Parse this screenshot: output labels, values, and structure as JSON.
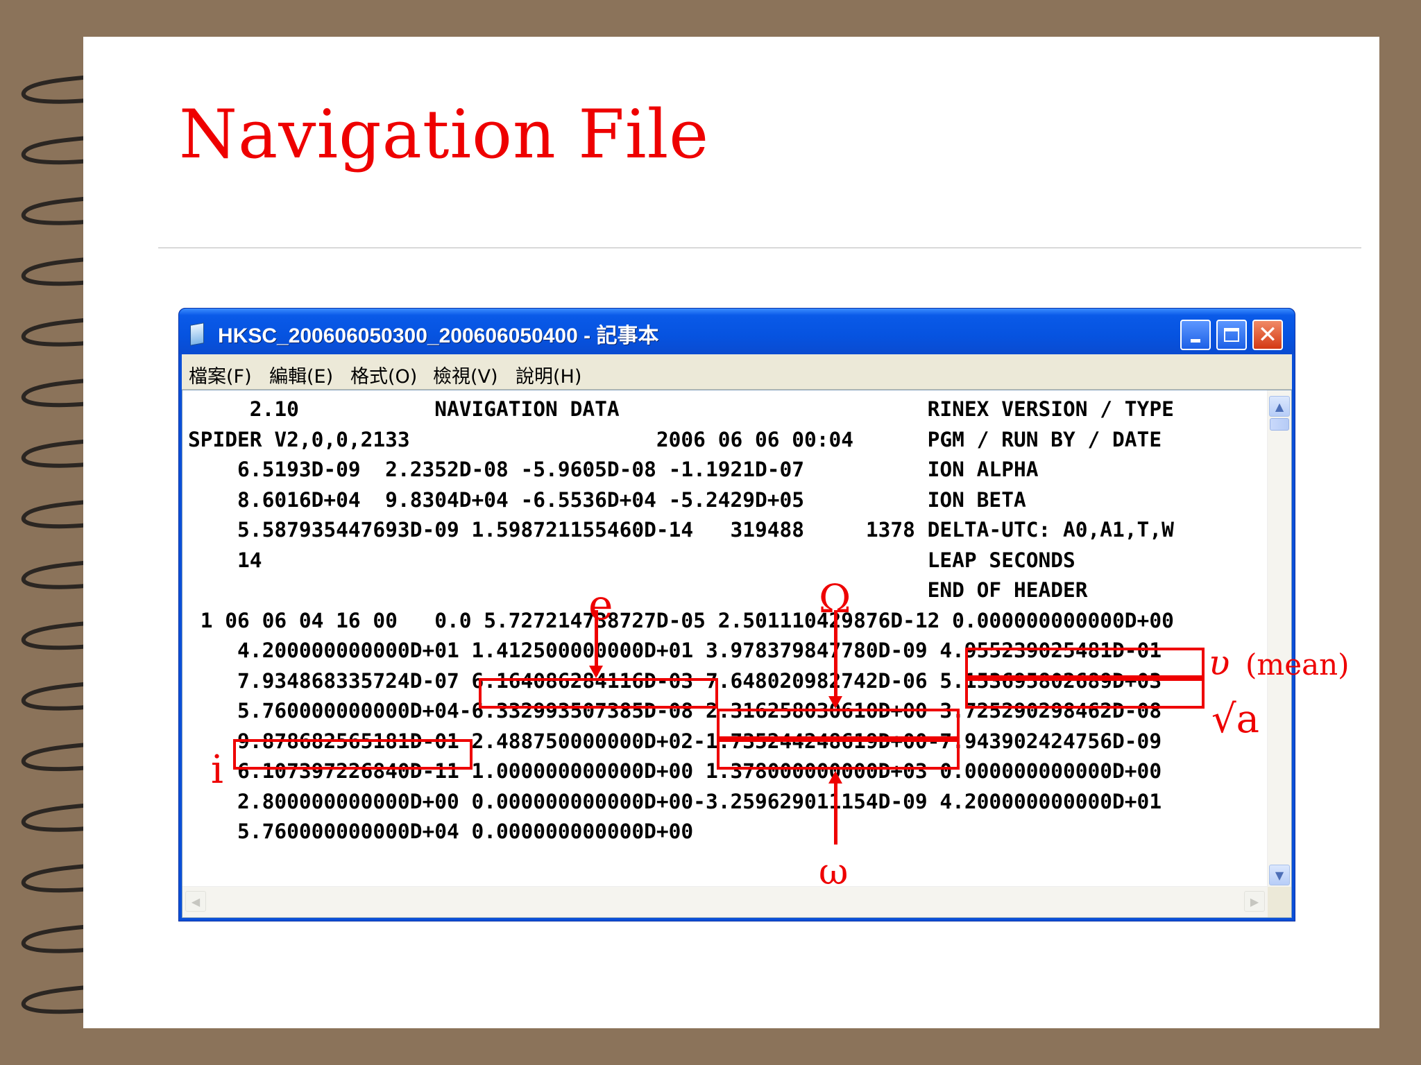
{
  "slide": {
    "title": "Navigation File"
  },
  "window": {
    "title": "HKSC_200606050300_200606050400 - 記事本",
    "menu": [
      "檔案(F)",
      "編輯(E)",
      "格式(O)",
      "檢視(V)",
      "說明(H)"
    ],
    "icons": {
      "app": "notepad-icon",
      "minimize": "minimize-icon",
      "maximize": "maximize-icon",
      "close": "close-icon"
    }
  },
  "file_lines": [
    "     2.10           NAVIGATION DATA                         RINEX VERSION / TYPE",
    "SPIDER V2,0,0,2133                    2006 06 06 00:04      PGM / RUN BY / DATE",
    "    6.5193D-09  2.2352D-08 -5.9605D-08 -1.1921D-07          ION ALPHA",
    "    8.6016D+04  9.8304D+04 -6.5536D+04 -5.2429D+05          ION BETA",
    "    5.587935447693D-09 1.598721155460D-14   319488     1378 DELTA-UTC: A0,A1,T,W",
    "    14                                                      LEAP SECONDS",
    "                                                            END OF HEADER",
    " 1 06 06 04 16 00   0.0 5.727214738727D-05 2.501110429876D-12 0.000000000000D+00",
    "    4.200000000000D+01 1.412500000000D+01 3.978379847780D-09 4.955239025481D-01",
    "    7.934868335724D-07 6.164086284116D-03 7.648020982742D-06 5.153695802689D+03",
    "    5.760000000000D+04-6.332993507385D-08 2.316258030610D+00 3.725290298462D-08",
    "    9.878682565181D-01 2.488750000000D+02-1.735244248619D+00-7.943902424756D-09",
    "    6.107397226840D-11 1.000000000000D+00 1.378000000000D+03 0.000000000000D+00",
    "    2.800000000000D+00 0.000000000000D+00-3.259629011154D-09 4.200000000000D+01",
    "    5.760000000000D+04 0.000000000000D+00"
  ],
  "annotations": {
    "e": "e",
    "Omega": "Ω",
    "omega": "ω",
    "i": "i",
    "nu": "υ",
    "nu_note": "(mean)",
    "sqrt_a": "√a"
  },
  "colors": {
    "accent": "#ee0000",
    "background": "#8b735a",
    "window_blue": "#0a4fd8"
  }
}
